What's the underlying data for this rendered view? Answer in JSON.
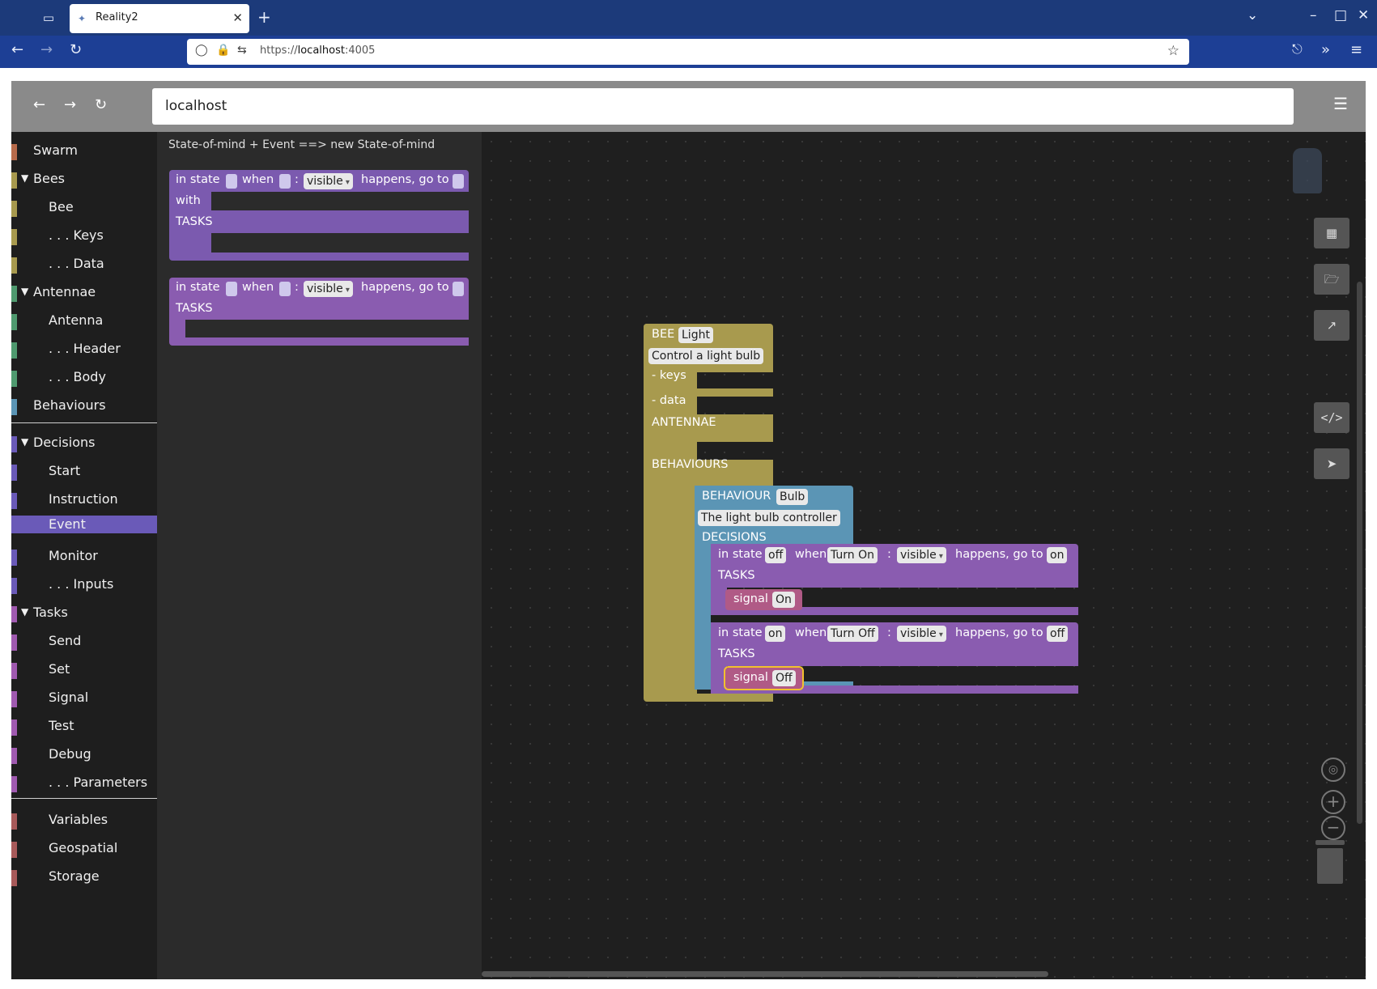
{
  "browser": {
    "tab_title": "Reality2",
    "url_prefix": "https://",
    "url_host": "localhost",
    "url_suffix": ":4005"
  },
  "app": {
    "address": "localhost"
  },
  "toolbox": {
    "categories": [
      {
        "label": "Swarm",
        "color": "#b86b4b"
      },
      {
        "label": "Bees",
        "color": "#a89a4e",
        "expanded": true
      },
      {
        "label": "Bee",
        "color": "#a89a4e"
      },
      {
        "label": ". . . Keys",
        "color": "#a89a4e"
      },
      {
        "label": ". . . Data",
        "color": "#a89a4e"
      },
      {
        "label": "Antennae",
        "color": "#4f9a6f",
        "expanded": true
      },
      {
        "label": "Antenna",
        "color": "#4f9a6f"
      },
      {
        "label": ". . . Header",
        "color": "#4f9a6f"
      },
      {
        "label": ". . . Body",
        "color": "#4f9a6f"
      },
      {
        "label": "Behaviours",
        "color": "#5b95b5"
      },
      {
        "label": "Decisions",
        "color": "#6a5ab8",
        "expanded": true
      },
      {
        "label": "Start",
        "color": "#6a5ab8"
      },
      {
        "label": "Instruction",
        "color": "#6a5ab8"
      },
      {
        "label": "Event",
        "color": "#6a5ab8",
        "selected": true
      },
      {
        "label": "Monitor",
        "color": "#6a5ab8"
      },
      {
        "label": ". . . Inputs",
        "color": "#6a5ab8"
      },
      {
        "label": "Tasks",
        "color": "#a05ab0",
        "expanded": true
      },
      {
        "label": "Send",
        "color": "#a05ab0"
      },
      {
        "label": "Set",
        "color": "#a05ab0"
      },
      {
        "label": "Signal",
        "color": "#a05ab0"
      },
      {
        "label": "Test",
        "color": "#a05ab0"
      },
      {
        "label": "Debug",
        "color": "#a05ab0"
      },
      {
        "label": ". . . Parameters",
        "color": "#a05ab0"
      },
      {
        "label": "Variables",
        "color": "#a85a5a"
      },
      {
        "label": "Geospatial",
        "color": "#a85a5a"
      },
      {
        "label": "Storage",
        "color": "#a85a5a"
      }
    ]
  },
  "flyout": {
    "hint": "State-of-mind + Event ==> new State-of-mind",
    "block1": {
      "in_state": "in state",
      "when": "when",
      "colon": ":",
      "dropdown": "visible",
      "happens": "happens, go to",
      "with": "with",
      "tasks": "TASKS"
    },
    "block2": {
      "in_state": "in state",
      "when": "when",
      "colon": ":",
      "dropdown": "visible",
      "happens": "happens, go to",
      "tasks": "TASKS"
    }
  },
  "workspace": {
    "bee": {
      "keyword": "BEE",
      "name": "Light",
      "description": "Control a light bulb",
      "keys": "- keys",
      "data": "- data",
      "antennae": "ANTENNAE",
      "behaviours": "BEHAVIOURS"
    },
    "behaviour": {
      "keyword": "BEHAVIOUR",
      "name": "Bulb",
      "description": "The light bulb controller",
      "decisions": "DECISIONS"
    },
    "decision1": {
      "in_state": "in state",
      "state": "off",
      "when": "when",
      "event": "Turn On",
      "colon": ":",
      "visibility": "visible",
      "happens": "happens, go to",
      "next": "on",
      "tasks": "TASKS",
      "signal_kw": "signal",
      "signal": "On"
    },
    "decision2": {
      "in_state": "in state",
      "state": "on",
      "when": "when",
      "event": "Turn Off",
      "colon": ":",
      "visibility": "visible",
      "happens": "happens, go to",
      "next": "off",
      "tasks": "TASKS",
      "signal_kw": "signal",
      "signal": "Off"
    }
  }
}
